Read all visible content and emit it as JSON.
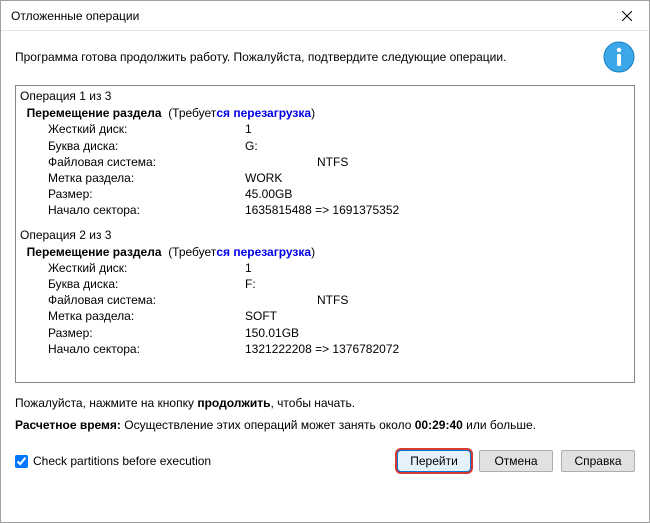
{
  "window": {
    "title": "Отложенные операции"
  },
  "header": {
    "message": "Программа готова продолжить работу. Пожалуйста, подтвердите следующие операции."
  },
  "labels": {
    "hdd": "Жесткий диск:",
    "drive_letter": "Буква диска:",
    "filesystem": "Файловая система:",
    "volume_label": "Метка раздела:",
    "size": "Размер:",
    "start_sector": "Начало сектора:",
    "requires_prefix": "(Требует",
    "requires_reboot": "ся перезагрузка",
    "requires_suffix": ")"
  },
  "operations": [
    {
      "counter": "Операция 1 из 3",
      "name": "Перемещение раздела",
      "hdd": "1",
      "drive_letter": "G:",
      "filesystem": "NTFS",
      "volume_label": "WORK",
      "size": "45.00GB",
      "start_sector": "1635815488 => 1691375352"
    },
    {
      "counter": "Операция 2 из 3",
      "name": "Перемещение раздела",
      "hdd": "1",
      "drive_letter": "F:",
      "filesystem": "NTFS",
      "volume_label": "SOFT",
      "size": "150.01GB",
      "start_sector": "1321222208 => 1376782072"
    }
  ],
  "hint": {
    "prefix": "Пожалуйста, нажмите на кнопку ",
    "bold": "продолжить",
    "suffix": ", чтобы начать."
  },
  "estimate": {
    "label": "Расчетное время: ",
    "text_prefix": "Осуществление этих операций может занять около ",
    "time": "00:29:40",
    "text_suffix": " или больше."
  },
  "footer": {
    "checkbox_label": "Check partitions before execution",
    "checkbox_checked": true,
    "btn_go": "Перейти",
    "btn_cancel": "Отмена",
    "btn_help": "Справка"
  }
}
